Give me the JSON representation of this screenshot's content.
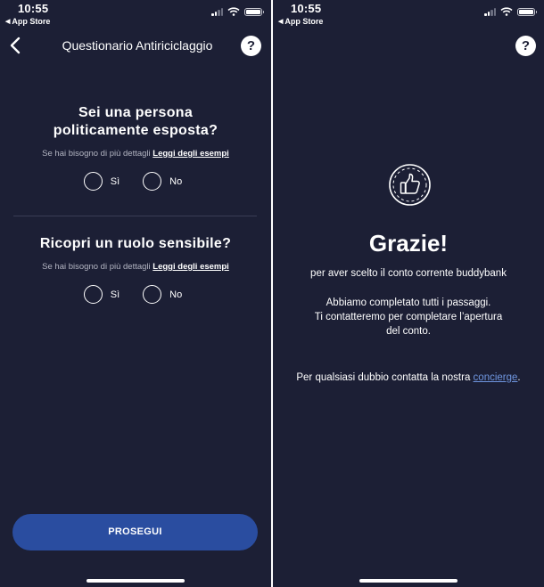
{
  "status_bar": {
    "time": "10:55",
    "back_app": "App Store"
  },
  "questionnaire": {
    "title": "Questionario Antiriciclaggio",
    "help_label": "?",
    "questions": [
      {
        "title_line1": "Sei una persona",
        "title_line2": "politicamente esposta?",
        "hint": "Se hai bisogno di più dettagli",
        "hint_link": "Leggi degli esempi",
        "options": [
          "Sì",
          "No"
        ]
      },
      {
        "title_line1": "Ricopri un ruolo sensibile?",
        "hint": "Se hai bisogno di più dettagli",
        "hint_link": "Leggi degli esempi",
        "options": [
          "Sì",
          "No"
        ]
      }
    ],
    "continue_label": "PROSEGUI"
  },
  "confirmation": {
    "help_label": "?",
    "icon": "thumbs-up-icon",
    "title": "Grazie!",
    "subtitle": "per aver scelto il conto corrente buddybank",
    "body_lines": [
      "Abbiamo completato tutti i passaggi.",
      "Ti contatteremo per completare l’apertura",
      "del conto."
    ],
    "contact_text": "Per qualsiasi dubbio contatta la nostra",
    "contact_link": "concierge",
    "contact_end": "."
  },
  "colors": {
    "background": "#1c1f35",
    "button": "#2a4da0",
    "link": "#6f96e0"
  }
}
